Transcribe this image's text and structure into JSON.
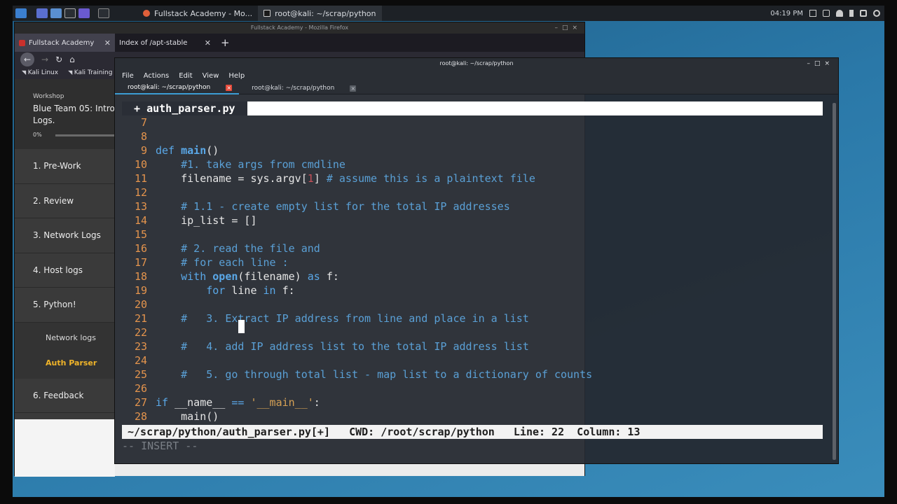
{
  "taskbar": {
    "tasks": [
      {
        "label": "Fullstack Academy - Mo..."
      },
      {
        "label": "root@kali: ~/scrap/python"
      }
    ],
    "clock": "04:19 PM"
  },
  "firefox": {
    "window_title": "Fullstack Academy - Mozilla Firefox",
    "tabs": [
      {
        "label": "Fullstack Academy"
      },
      {
        "label": "Index of /apt-stable"
      }
    ],
    "new_tab": "+",
    "bookmarks": [
      "Kali Linux",
      "Kali Training"
    ]
  },
  "course": {
    "workshop_label": "Workshop",
    "workshop_title": "Blue Team 05: Intro",
    "workshop_title_2": "Logs.",
    "progress_text": "0%",
    "progress_value": 0,
    "nav": [
      {
        "label": "1. Pre-Work"
      },
      {
        "label": "2. Review"
      },
      {
        "label": "3. Network Logs"
      },
      {
        "label": "4. Host logs"
      },
      {
        "label": "5. Python!"
      }
    ],
    "subnav": [
      {
        "label": "Network logs"
      },
      {
        "label": "Auth Parser"
      }
    ],
    "feedback": "6. Feedback"
  },
  "terminal": {
    "window_title": "root@kali: ~/scrap/python",
    "menu": [
      "File",
      "Actions",
      "Edit",
      "View",
      "Help"
    ],
    "tabs": [
      {
        "label": "root@kali: ~/scrap/python"
      },
      {
        "label": "root@kali: ~/scrap/python"
      }
    ]
  },
  "vim": {
    "buffer_tab": " + auth_parser.py ",
    "lines": {
      "l7": "7",
      "l8": "8",
      "l9": "9",
      "l10": "10",
      "c10": "#1. take args from cmdline",
      "l11": "11",
      "c11": "# assume this is a plaintext file",
      "l12": "12",
      "l13": "13",
      "c13": "# 1.1 - create empty list for the total IP addresses",
      "l14": "14",
      "l15": "15",
      "l16": "16",
      "c16": "# 2. read the file and",
      "l17": "17",
      "c17": "# for each line :",
      "l18": "18",
      "l19": "19",
      "l20": "20",
      "l21": "21",
      "c21": "#   3. Extract IP address from line and place in a list",
      "l22": "22",
      "l23": "23",
      "c23": "#   4. add IP address list to the total IP address list",
      "l24": "24",
      "l25": "25",
      "c25": "#   5. go through total list - map list to a dictionary of counts",
      "l26": "26",
      "l27": "27",
      "l28": "28"
    },
    "status": "~/scrap/python/auth_parser.py[+]   CWD: /root/scrap/python   Line: 22  Column: 13",
    "mode": "-- INSERT --"
  }
}
